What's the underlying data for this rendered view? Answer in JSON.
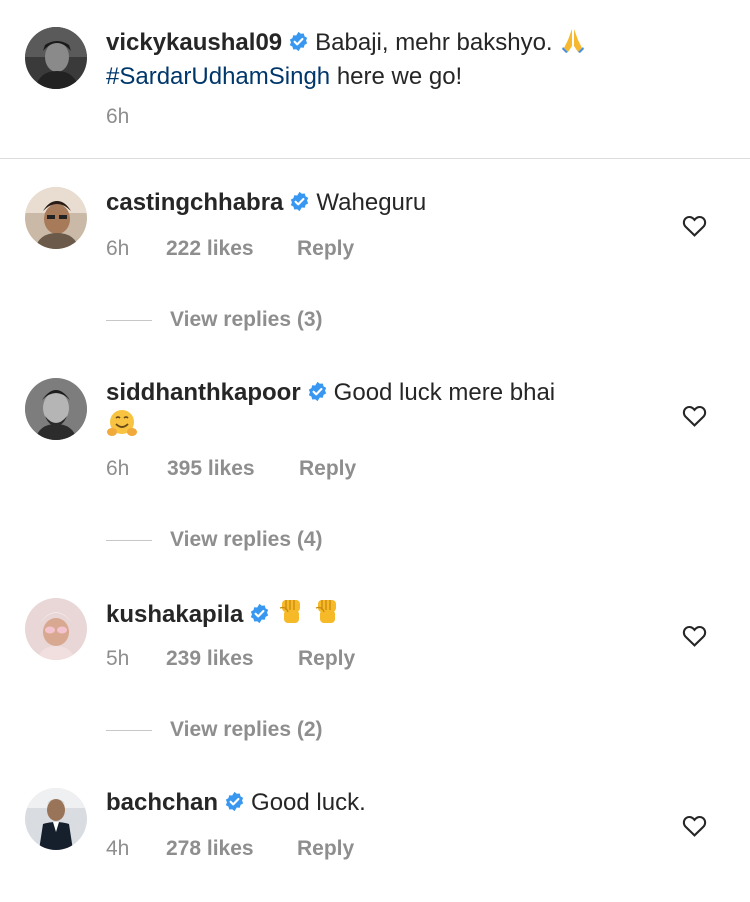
{
  "post": {
    "username": "vickykaushal09",
    "caption_part1": "Babaji, mehr bakshyo.",
    "caption_emoji": "folded-hands-emoji",
    "hashtag": "#SardarUdhamSingh",
    "caption_part2": "here we go!",
    "time": "6h"
  },
  "comments": [
    {
      "username": "castingchhabra",
      "text": "Waheguru",
      "time": "6h",
      "likes": "222 likes",
      "reply": "Reply",
      "view_replies": "View replies (3)"
    },
    {
      "username": "siddhanthkapoor",
      "text": "Good luck mere bhai",
      "emoji": "hugging-face-emoji",
      "time": "6h",
      "likes": "395 likes",
      "reply": "Reply",
      "view_replies": "View replies (4)"
    },
    {
      "username": "kushakapila",
      "text": "",
      "emoji": "raised-fist-emoji x2",
      "time": "5h",
      "likes": "239 likes",
      "reply": "Reply",
      "view_replies": "View replies (2)"
    },
    {
      "username": "bachchan",
      "text": "Good luck.",
      "time": "4h",
      "likes": "278 likes",
      "reply": "Reply"
    }
  ],
  "colors": {
    "text": "#262626",
    "muted": "#8e8e8e",
    "link": "#00376b",
    "verified": "#3897f0",
    "divider": "#dbdbdb"
  }
}
